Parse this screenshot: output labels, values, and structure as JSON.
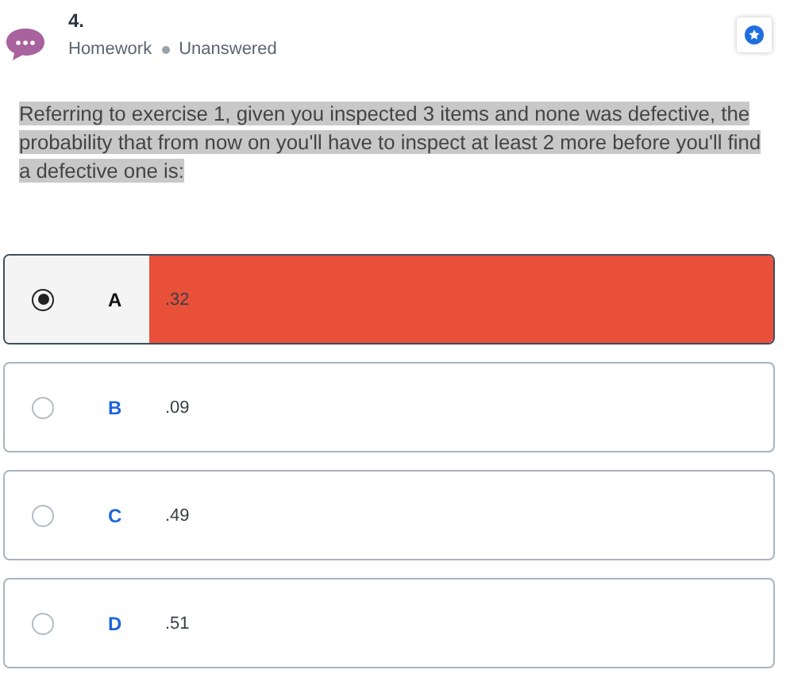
{
  "question": {
    "number": "4.",
    "category": "Homework",
    "status": "Unanswered",
    "text": "Referring to exercise 1, given you inspected 3 items and none was defective, the probability that from now on you'll have to inspect at least 2 more before you'll find a defective one is:"
  },
  "options": [
    {
      "letter": "A",
      "value": ".32",
      "selected": true
    },
    {
      "letter": "B",
      "value": ".09",
      "selected": false
    },
    {
      "letter": "C",
      "value": ".49",
      "selected": false
    },
    {
      "letter": "D",
      "value": ".51",
      "selected": false
    }
  ]
}
